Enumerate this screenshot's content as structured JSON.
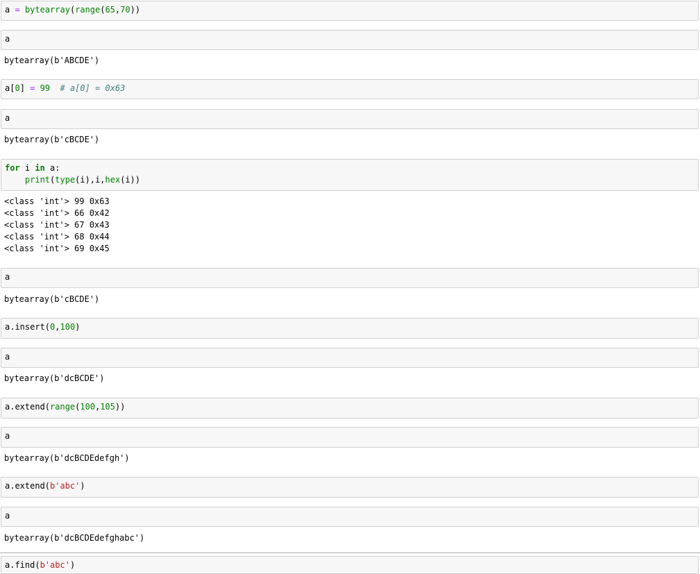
{
  "cells": [
    {
      "id": "c1",
      "input": [
        "a = bytearray(range(65,70))"
      ],
      "output": []
    },
    {
      "id": "c2",
      "input": [
        "a"
      ],
      "output": [
        "bytearray(b'ABCDE')"
      ]
    },
    {
      "id": "c3",
      "input": [
        "a[0] = 99  # a[0] = 0x63"
      ],
      "output": []
    },
    {
      "id": "c4",
      "input": [
        "a"
      ],
      "output": [
        "bytearray(b'cBCDE')"
      ]
    },
    {
      "id": "c5",
      "input": [
        "for i in a:",
        "    print(type(i),i,hex(i))"
      ],
      "output": [
        "<class 'int'> 99 0x63",
        "<class 'int'> 66 0x42",
        "<class 'int'> 67 0x43",
        "<class 'int'> 68 0x44",
        "<class 'int'> 69 0x45"
      ]
    },
    {
      "id": "c6",
      "input": [
        "a"
      ],
      "output": [
        "bytearray(b'cBCDE')"
      ]
    },
    {
      "id": "c7",
      "input": [
        "a.insert(0,100)"
      ],
      "output": []
    },
    {
      "id": "c8",
      "input": [
        "a"
      ],
      "output": [
        "bytearray(b'dcBCDE')"
      ]
    },
    {
      "id": "c9",
      "input": [
        "a.extend(range(100,105))"
      ],
      "output": []
    },
    {
      "id": "c10",
      "input": [
        "a"
      ],
      "output": [
        "bytearray(b'dcBCDEdefgh')"
      ]
    },
    {
      "id": "c11",
      "input": [
        "a.extend(b'abc')"
      ],
      "output": []
    },
    {
      "id": "c12",
      "input": [
        "a"
      ],
      "output": [
        "bytearray(b'dcBCDEdefghabc')"
      ]
    },
    {
      "id": "c13",
      "input": [
        "a.find(b'abc')"
      ],
      "output": []
    }
  ],
  "colors": {
    "keyword": "#008000",
    "builtin": "#008000",
    "number": "#008000",
    "string": "#ba2121",
    "operator": "#aa22ff",
    "comment": "#408080",
    "cell_background": "#f7f7f7",
    "cell_border": "#cfcfcf"
  }
}
